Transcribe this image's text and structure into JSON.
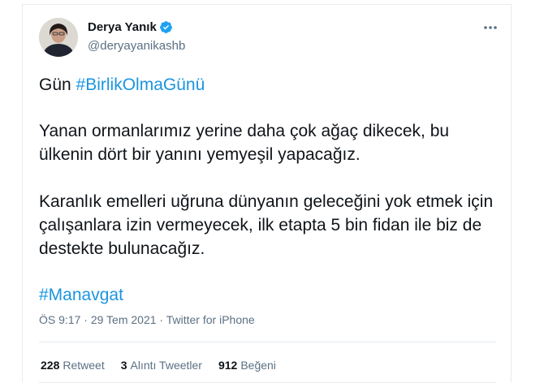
{
  "author": {
    "name": "Derya Yanık",
    "handle": "@deryayanikashb"
  },
  "tweet": {
    "line1_prefix": "Gün",
    "line1_hashtag": "#BirlikOlmaGünü",
    "paragraph2": "Yanan ormanlarımız yerine daha çok ağaç dikecek, bu ülkenin dört bir yanını yemyeşil yapacağız.",
    "paragraph3": "Karanlık emelleri uğruna dünyanın geleceğini yok etmek için çalışanlara izin vermeyecek, ilk etapta 5 bin fidan ile biz de destekte bulunacağız.",
    "hashtag2": "#Manavgat"
  },
  "meta": {
    "time": "ÖS 9:17",
    "date": "29 Tem 2021",
    "source": "Twitter for iPhone",
    "separator": "·"
  },
  "stats": {
    "retweets_count": "228",
    "retweets_label": "Retweet",
    "quotes_count": "3",
    "quotes_label": "Alıntı Tweetler",
    "likes_count": "912",
    "likes_label": "Beğeni"
  },
  "colors": {
    "link": "#1b95e0",
    "secondary_text": "#5b7083",
    "verified": "#1da1f2"
  },
  "icons": [
    "verified-badge-icon",
    "more-options-icon"
  ]
}
